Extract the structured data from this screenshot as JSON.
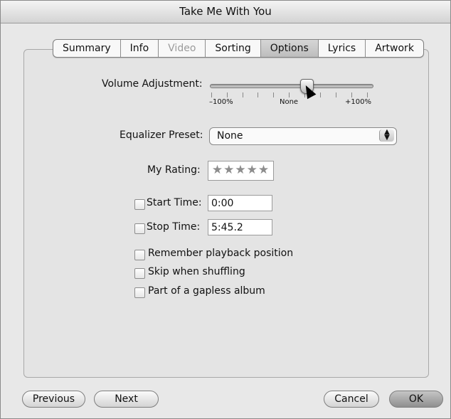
{
  "window": {
    "title": "Take Me With You"
  },
  "tabs": [
    {
      "label": "Summary",
      "state": "normal"
    },
    {
      "label": "Info",
      "state": "normal"
    },
    {
      "label": "Video",
      "state": "disabled"
    },
    {
      "label": "Sorting",
      "state": "normal"
    },
    {
      "label": "Options",
      "state": "selected"
    },
    {
      "label": "Lyrics",
      "state": "normal"
    },
    {
      "label": "Artwork",
      "state": "normal"
    }
  ],
  "options": {
    "volume_adjustment_label": "Volume Adjustment:",
    "volume_scale": {
      "min": "–100%",
      "mid": "None",
      "max": "+100%",
      "value": "None"
    },
    "equalizer_label": "Equalizer Preset:",
    "equalizer_value": "None",
    "rating_label": "My Rating:",
    "rating_stars": "★★★★★",
    "start_time_label": "Start Time:",
    "start_time_value": "0:00",
    "stop_time_label": "Stop Time:",
    "stop_time_value": "5:45.2",
    "remember_playback_label": "Remember playback position",
    "skip_when_shuffling_label": "Skip when shuffling",
    "gapless_album_label": "Part of a gapless album"
  },
  "buttons": {
    "previous": "Previous",
    "next": "Next",
    "cancel": "Cancel",
    "ok": "OK"
  },
  "icons": {
    "cursor": "pointer-arrow-icon",
    "select": "up-down-arrows-icon"
  }
}
